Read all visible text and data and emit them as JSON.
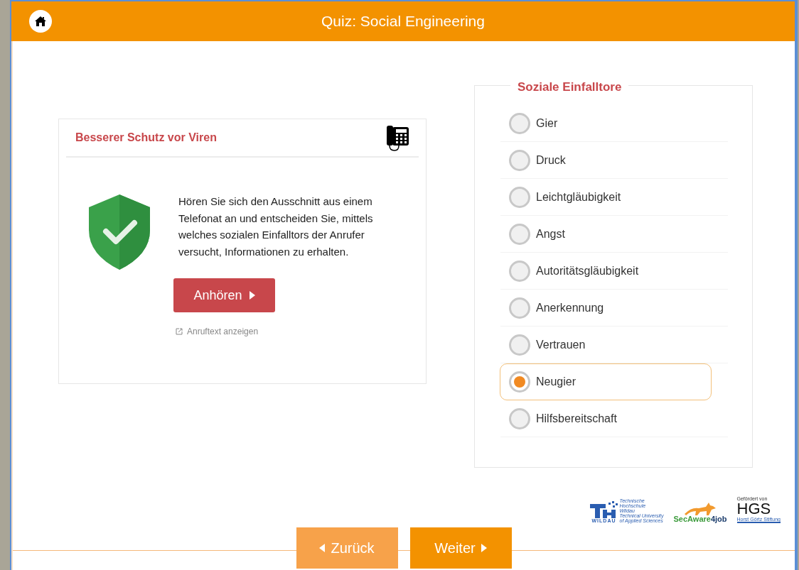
{
  "header": {
    "title": "Quiz: Social Engineering"
  },
  "card": {
    "title": "Besserer Schutz vor Viren",
    "text": "Hören Sie sich den Ausschnitt aus einem Telefonat an und entscheiden Sie, mittels welches sozialen Einfalltors der Anrufer versucht, Informationen zu erhalten.",
    "listen_button": "Anhören",
    "link": "Anruftext anzeigen"
  },
  "question": {
    "legend": "Soziale Einfalltore",
    "options": [
      {
        "label": "Gier",
        "selected": false
      },
      {
        "label": "Druck",
        "selected": false
      },
      {
        "label": "Leichtgläubigkeit",
        "selected": false
      },
      {
        "label": "Angst",
        "selected": false
      },
      {
        "label": "Autoritätsgläubigkeit",
        "selected": false
      },
      {
        "label": "Anerkennung",
        "selected": false
      },
      {
        "label": "Vertrauen",
        "selected": false
      },
      {
        "label": "Neugier",
        "selected": true
      },
      {
        "label": "Hilfsbereitschaft",
        "selected": false
      }
    ]
  },
  "navigation": {
    "back": "Zurück",
    "next": "Weiter"
  },
  "logos": {
    "th_text": [
      "Technische",
      "Hochschule",
      "Wildau",
      "Technical University",
      "of Applied Sciences"
    ],
    "th_name": "WILDAU",
    "fox_name": "SecAware",
    "fox_suffix": "4job",
    "hgs_caption": "Gefördert von",
    "hgs_name": "HGS",
    "hgs_sub": "Horst Görtz Stiftung"
  }
}
